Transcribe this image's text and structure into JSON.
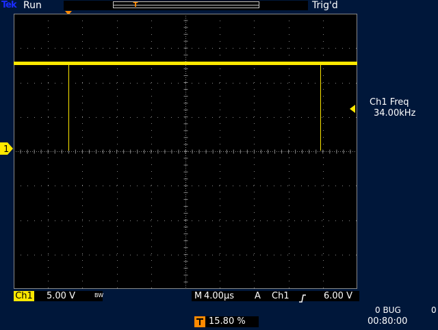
{
  "header": {
    "brand": "Tek",
    "run_status": "Run",
    "trig_status": "Trig'd"
  },
  "markers": {
    "trigger_position_icon": "trigger-T-icon",
    "ch1_marker_label": "1"
  },
  "measurement": {
    "label": "Ch1 Freq",
    "value": "34.00kHz"
  },
  "channel": {
    "badge": "Ch1",
    "scale": "5.00 V",
    "bw_flag": "BW"
  },
  "timebase": {
    "mode": "M",
    "value": "4.00µs"
  },
  "trigger": {
    "mode": "A",
    "source": "Ch1",
    "slope_icon": "rising-edge-icon",
    "level": "6.00 V"
  },
  "status": {
    "line1": "0 BUG",
    "right": "0",
    "line2": "00:80:00"
  },
  "trigger_position": {
    "icon": "trigger-T-icon",
    "value": "15.80 %"
  },
  "colors": {
    "background": "#00173a",
    "graticule_bg": "#000000",
    "trace": "#ffe800",
    "trigger": "#ff8a00",
    "grid": "#8a8a8a"
  }
}
